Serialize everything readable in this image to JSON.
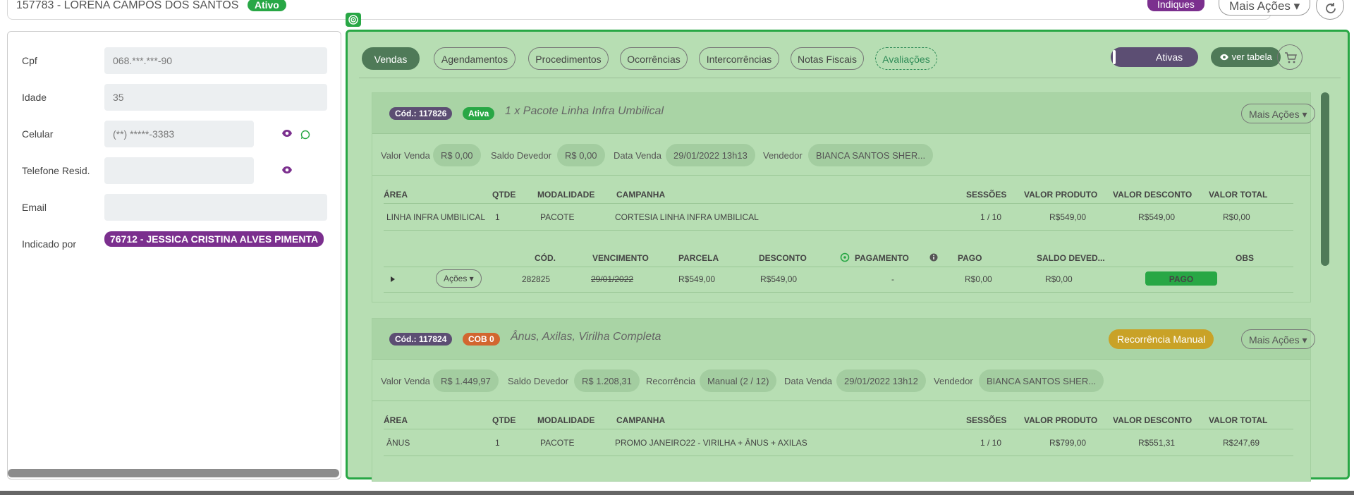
{
  "header": {
    "patient": "157783 - LORENA CAMPOS DOS SANTOS",
    "status": "Ativo",
    "indiques_label": "Indiques",
    "mais_acoes_label": "Mais Ações ▾"
  },
  "patient_fields": {
    "cpf_label": "Cpf",
    "cpf_value": "068.***.***-90",
    "idade_label": "Idade",
    "idade_value": "35",
    "celular_label": "Celular",
    "celular_value": "(**) *****-3383",
    "telefone_label": "Telefone Resid.",
    "telefone_value": "",
    "email_label": "Email",
    "email_value": "",
    "indicado_label": "Indicado por",
    "indicado_value": "76712 - JESSICA CRISTINA ALVES PIMENTA"
  },
  "tabs": [
    "Vendas",
    "Agendamentos",
    "Procedimentos",
    "Ocorrências",
    "Intercorrências",
    "Notas Fiscais",
    "Avaliações"
  ],
  "toolbar": {
    "ativas_label": "Ativas",
    "ver_tabela_label": "ver tabela"
  },
  "sale1": {
    "code": "Cód.: 117826",
    "status": "Ativa",
    "title": "1 x Pacote Linha Infra Umbilical",
    "mais_acoes": "Mais Ações ▾",
    "valor_venda_label": "Valor Venda",
    "valor_venda": "R$ 0,00",
    "saldo_label": "Saldo Devedor",
    "saldo": "R$ 0,00",
    "data_label": "Data Venda",
    "data": "29/01/2022 13h13",
    "vendedor_label": "Vendedor",
    "vendedor": "BIANCA SANTOS SHER...",
    "items_headers": [
      "ÁREA",
      "QTDE",
      "MODALIDADE",
      "CAMPANHA",
      "SESSÕES",
      "VALOR PRODUTO",
      "VALOR DESCONTO",
      "VALOR TOTAL"
    ],
    "items": [
      [
        "LINHA INFRA UMBILICAL",
        "1",
        "PACOTE",
        "CORTESIA LINHA INFRA UMBILICAL",
        "1 / 10",
        "R$549,00",
        "R$549,00",
        "R$0,00"
      ]
    ],
    "pay_headers": [
      "CÓD.",
      "VENCIMENTO",
      "PARCELA",
      "DESCONTO",
      "PAGAMENTO",
      "PAGO",
      "SALDO DEVED...",
      "OBS"
    ],
    "payments": [
      {
        "acoes": "Ações ▾",
        "cod": "282825",
        "vencimento": "29/01/2022",
        "parcela": "R$549,00",
        "desconto": "R$549,00",
        "pagamento": "-",
        "pago": "R$0,00",
        "saldo": "R$0,00",
        "status": "PAGO"
      }
    ]
  },
  "sale2": {
    "code": "Cód.: 117824",
    "status": "COB 0",
    "title": "Ânus, Axilas, Virilha Completa",
    "recorrencia_btn": "Recorrência Manual",
    "mais_acoes": "Mais Ações ▾",
    "valor_venda_label": "Valor Venda",
    "valor_venda": "R$ 1.449,97",
    "saldo_label": "Saldo Devedor",
    "saldo": "R$ 1.208,31",
    "recorrencia_label": "Recorrência",
    "recorrencia": "Manual (2 / 12)",
    "data_label": "Data Venda",
    "data": "29/01/2022 13h12",
    "vendedor_label": "Vendedor",
    "vendedor": "BIANCA SANTOS SHER...",
    "items_headers": [
      "ÁREA",
      "QTDE",
      "MODALIDADE",
      "CAMPANHA",
      "SESSÕES",
      "VALOR PRODUTO",
      "VALOR DESCONTO",
      "VALOR TOTAL"
    ],
    "items": [
      [
        "ÂNUS",
        "1",
        "PACOTE",
        "PROMO JANEIRO22 - VIRILHA + ÂNUS + AXILAS",
        "1 / 10",
        "R$799,00",
        "R$551,31",
        "R$247,69"
      ]
    ]
  },
  "colors": {
    "green": "#28a745",
    "purple": "#7b2f8e",
    "panel": "#b7deb3",
    "dark_green": "#4f7a58"
  }
}
